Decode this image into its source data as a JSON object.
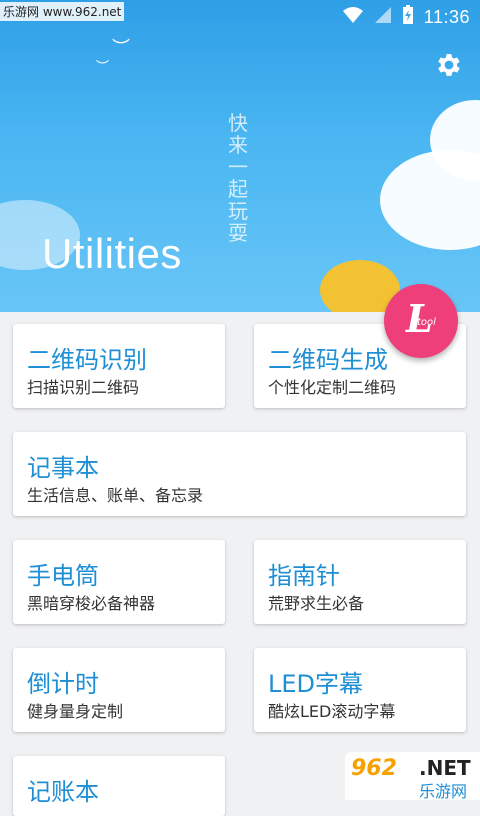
{
  "status": {
    "watermark": "乐游网 www.962.net",
    "time": "11:36"
  },
  "hero": {
    "slogan_chars": [
      "快",
      "来",
      "一",
      "起",
      "玩",
      "耍"
    ],
    "title": "Utilities"
  },
  "fab": {
    "letter": "L",
    "sub": "tool"
  },
  "cards": [
    {
      "title": "二维码识别",
      "subtitle": "扫描识别二维码"
    },
    {
      "title": "二维码生成",
      "subtitle": "个性化定制二维码"
    },
    {
      "title": "记事本",
      "subtitle": "生活信息、账单、备忘录"
    },
    {
      "title": "手电筒",
      "subtitle": "黑暗穿梭必备神器"
    },
    {
      "title": "指南针",
      "subtitle": "荒野求生必备"
    },
    {
      "title": "倒计时",
      "subtitle": "健身量身定制"
    },
    {
      "title": "LED字幕",
      "subtitle": "酷炫LED滚动字幕"
    },
    {
      "title": "记账本",
      "subtitle": ""
    }
  ],
  "watermark_br": {
    "logo": "962",
    "net": ".NET",
    "text": "乐游网"
  }
}
